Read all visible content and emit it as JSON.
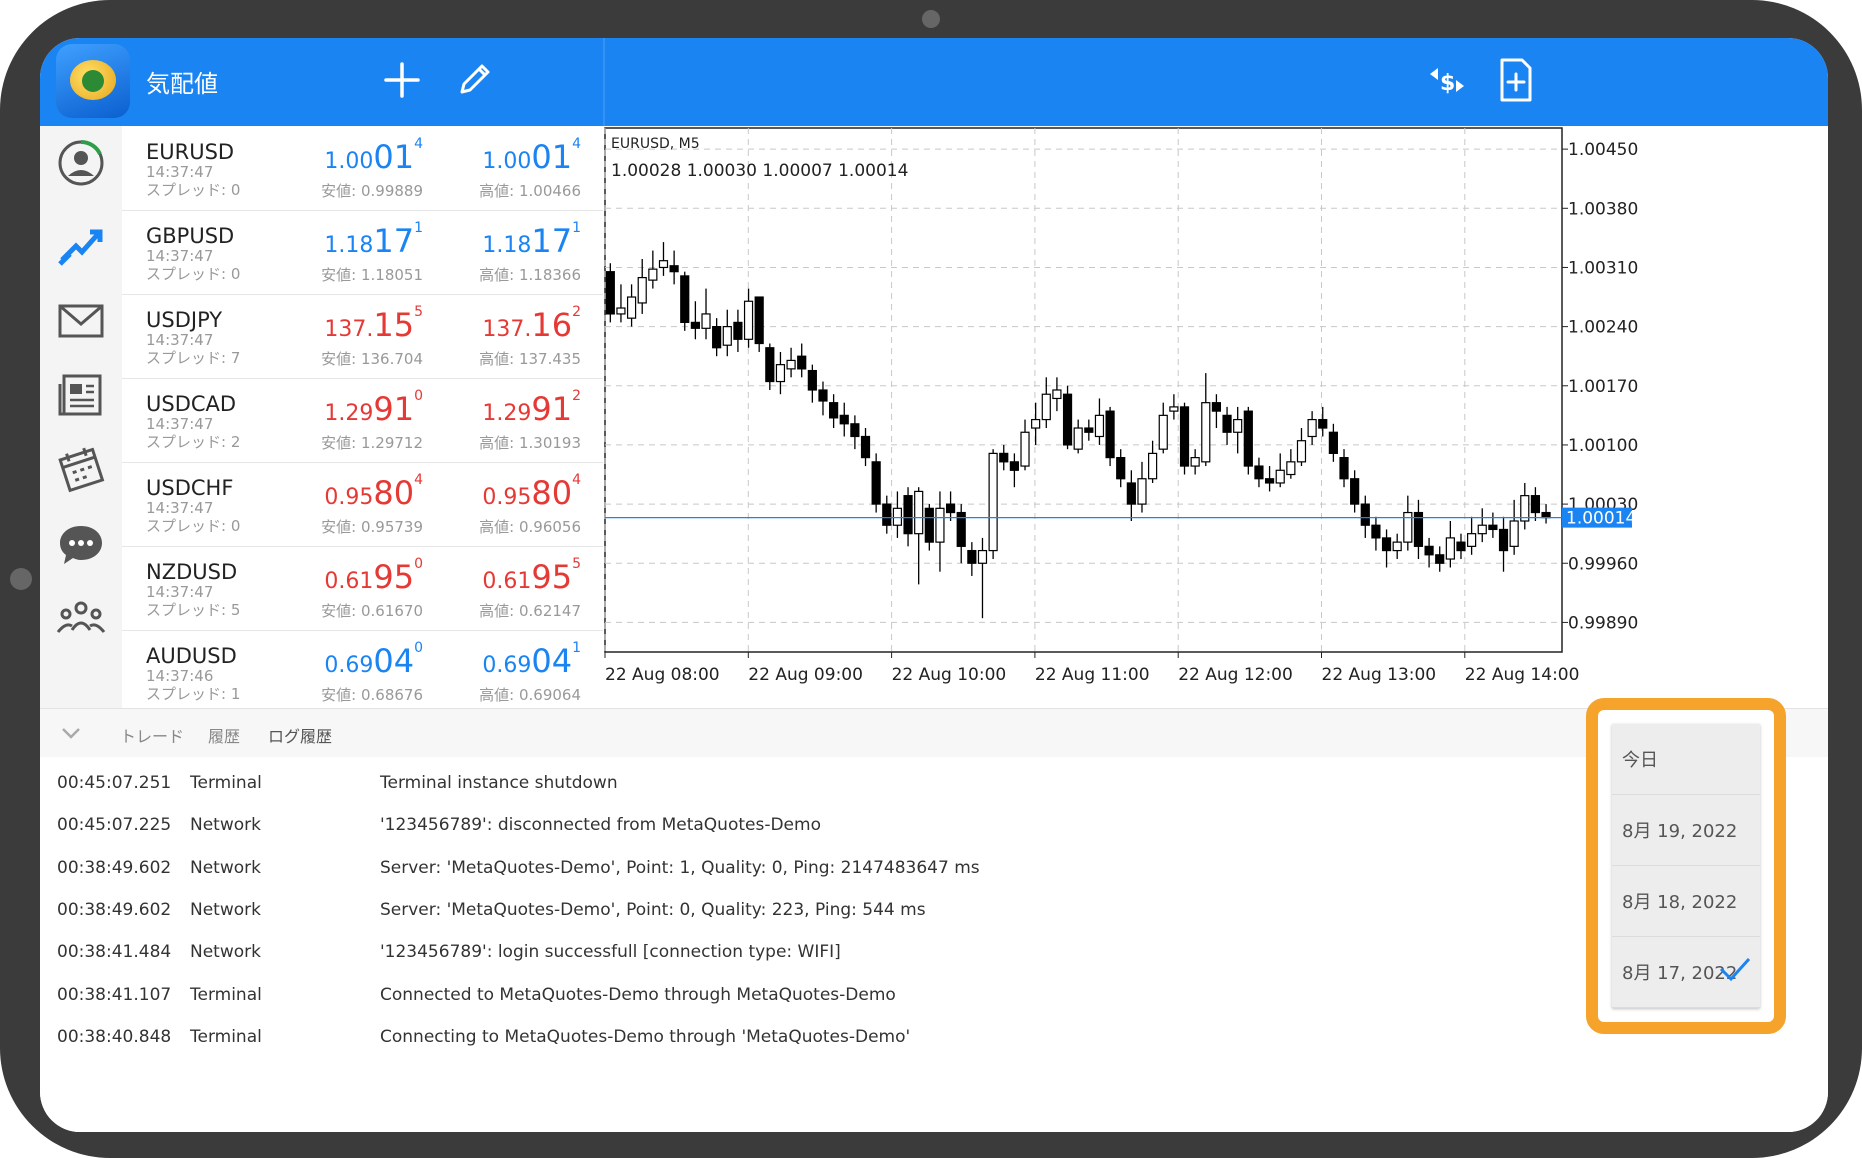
{
  "app": {
    "title": "気配値"
  },
  "quotes": [
    {
      "symbol": "EURUSD",
      "time": "14:37:47",
      "spread": "スプレッド: 0",
      "bid_pre": "1.00",
      "bid_big": "01",
      "bid_sup": "4",
      "ask_pre": "1.00",
      "ask_big": "01",
      "ask_sup": "4",
      "low": "安値: 0.99889",
      "high": "高値: 1.00466",
      "dir": "blue"
    },
    {
      "symbol": "GBPUSD",
      "time": "14:37:47",
      "spread": "スプレッド: 0",
      "bid_pre": "1.18",
      "bid_big": "17",
      "bid_sup": "1",
      "ask_pre": "1.18",
      "ask_big": "17",
      "ask_sup": "1",
      "low": "安値: 1.18051",
      "high": "高値: 1.18366",
      "dir": "blue"
    },
    {
      "symbol": "USDJPY",
      "time": "14:37:47",
      "spread": "スプレッド: 7",
      "bid_pre": "137.",
      "bid_big": "15",
      "bid_sup": "5",
      "ask_pre": "137.",
      "ask_big": "16",
      "ask_sup": "2",
      "low": "安値: 136.704",
      "high": "高値: 137.435",
      "dir": "red"
    },
    {
      "symbol": "USDCAD",
      "time": "14:37:47",
      "spread": "スプレッド: 2",
      "bid_pre": "1.29",
      "bid_big": "91",
      "bid_sup": "0",
      "ask_pre": "1.29",
      "ask_big": "91",
      "ask_sup": "2",
      "low": "安値: 1.29712",
      "high": "高値: 1.30193",
      "dir": "red"
    },
    {
      "symbol": "USDCHF",
      "time": "14:37:47",
      "spread": "スプレッド: 0",
      "bid_pre": "0.95",
      "bid_big": "80",
      "bid_sup": "4",
      "ask_pre": "0.95",
      "ask_big": "80",
      "ask_sup": "4",
      "low": "安値: 0.95739",
      "high": "高値: 0.96056",
      "dir": "red"
    },
    {
      "symbol": "NZDUSD",
      "time": "14:37:47",
      "spread": "スプレッド: 5",
      "bid_pre": "0.61",
      "bid_big": "95",
      "bid_sup": "0",
      "ask_pre": "0.61",
      "ask_big": "95",
      "ask_sup": "5",
      "low": "安値: 0.61670",
      "high": "高値: 0.62147",
      "dir": "red"
    },
    {
      "symbol": "AUDUSD",
      "time": "14:37:46",
      "spread": "スプレッド: 1",
      "bid_pre": "0.69",
      "bid_big": "04",
      "bid_sup": "0",
      "ask_pre": "0.69",
      "ask_big": "04",
      "ask_sup": "1",
      "low": "安値: 0.68676",
      "high": "高値: 0.69064",
      "dir": "blue"
    }
  ],
  "chart": {
    "symbol": "EURUSD, M5",
    "ohlc": "1.00028 1.00030 1.00007 1.00014",
    "current_price": "1.00014",
    "current_value": 1.00014,
    "y_ticks": [
      "1.00450",
      "1.00380",
      "1.00310",
      "1.00240",
      "1.00170",
      "1.00100",
      "1.00030",
      "0.99960",
      "0.99890"
    ],
    "x_ticks": [
      "22 Aug 08:00",
      "22 Aug 09:00",
      "22 Aug 10:00",
      "22 Aug 11:00",
      "22 Aug 12:00",
      "22 Aug 13:00",
      "22 Aug 14:00"
    ]
  },
  "chart_data": {
    "type": "candlestick",
    "title": "EURUSD, M5",
    "ylim": [
      0.99855,
      1.00475
    ],
    "x_range": [
      "22 Aug 08:00",
      "22 Aug 14:00"
    ],
    "grid": true,
    "last": 1.00014,
    "candles": [
      [
        1.00305,
        1.00255,
        1.00315,
        1.00245
      ],
      [
        1.00255,
        1.00262,
        1.0029,
        1.00245
      ],
      [
        1.0025,
        1.00275,
        1.0029,
        1.0024
      ],
      [
        1.00268,
        1.00298,
        1.0032,
        1.00255
      ],
      [
        1.00295,
        1.00308,
        1.0033,
        1.00285
      ],
      [
        1.0031,
        1.00318,
        1.0034,
        1.003
      ],
      [
        1.00312,
        1.00305,
        1.0033,
        1.0029
      ],
      [
        1.003,
        1.00245,
        1.00305,
        1.00235
      ],
      [
        1.00245,
        1.00238,
        1.0027,
        1.00225
      ],
      [
        1.00238,
        1.00255,
        1.00285,
        1.00225
      ],
      [
        1.0024,
        1.00215,
        1.0025,
        1.00205
      ],
      [
        1.00218,
        1.0024,
        1.0026,
        1.00205
      ],
      [
        1.00245,
        1.00225,
        1.0026,
        1.0021
      ],
      [
        1.00225,
        1.0027,
        1.00285,
        1.00215
      ],
      [
        1.00275,
        1.0022,
        1.00275,
        1.0021
      ],
      [
        1.00215,
        1.00175,
        1.0022,
        1.00165
      ],
      [
        1.00175,
        1.00195,
        1.0021,
        1.0016
      ],
      [
        1.0019,
        1.002,
        1.00215,
        1.0018
      ],
      [
        1.00205,
        1.0019,
        1.0022,
        1.0018
      ],
      [
        1.00188,
        1.00165,
        1.00195,
        1.0015
      ],
      [
        1.00165,
        1.00152,
        1.00175,
        1.00135
      ],
      [
        1.0015,
        1.00132,
        1.0016,
        1.0012
      ],
      [
        1.00135,
        1.00125,
        1.0015,
        1.0011
      ],
      [
        1.00125,
        1.0011,
        1.00135,
        1.00095
      ],
      [
        1.0011,
        1.00085,
        1.0012,
        1.00075
      ],
      [
        1.0008,
        1.0003,
        1.0009,
        1.0002
      ],
      [
        1.0003,
        1.00005,
        1.0004,
        0.99995
      ],
      [
        1.00005,
        1.00025,
        1.00045,
        0.9999
      ],
      [
        1.0004,
        0.99995,
        1.0005,
        0.9998
      ],
      [
        0.99995,
        1.00045,
        1.0005,
        0.99935
      ],
      [
        1.00025,
        0.99985,
        1.0003,
        0.99975
      ],
      [
        0.99985,
        1.00025,
        1.00045,
        0.9995
      ],
      [
        1.0003,
        1.0002,
        1.00045,
        1.0001
      ],
      [
        1.0002,
        0.9998,
        1.0003,
        0.9996
      ],
      [
        0.99975,
        0.9996,
        0.99985,
        0.99945
      ],
      [
        0.9996,
        0.99975,
        0.9999,
        0.99895
      ],
      [
        0.99975,
        1.0009,
        1.00095,
        0.99965
      ],
      [
        1.0009,
        1.0008,
        1.001,
        1.0007
      ],
      [
        1.0008,
        1.0007,
        1.0009,
        1.0005
      ],
      [
        1.00075,
        1.00115,
        1.0013,
        1.0007
      ],
      [
        1.0012,
        1.0013,
        1.0015,
        1.001
      ],
      [
        1.0013,
        1.0016,
        1.0018,
        1.0012
      ],
      [
        1.00155,
        1.00165,
        1.0018,
        1.0014
      ],
      [
        1.0016,
        1.001,
        1.0017,
        1.00095
      ],
      [
        1.00095,
        1.0012,
        1.0013,
        1.0009
      ],
      [
        1.0012,
        1.00115,
        1.0013,
        1.00105
      ],
      [
        1.0011,
        1.00135,
        1.00155,
        1.001
      ],
      [
        1.0014,
        1.00085,
        1.00145,
        1.00075
      ],
      [
        1.00085,
        1.0006,
        1.00095,
        1.0005
      ],
      [
        1.00055,
        1.0003,
        1.0007,
        1.0001
      ],
      [
        1.0003,
        1.0006,
        1.0008,
        1.0002
      ],
      [
        1.0006,
        1.0009,
        1.00105,
        1.00055
      ],
      [
        1.00095,
        1.00135,
        1.0015,
        1.0009
      ],
      [
        1.0014,
        1.00145,
        1.0016,
        1.0013
      ],
      [
        1.00145,
        1.00075,
        1.0015,
        1.00065
      ],
      [
        1.00075,
        1.00085,
        1.00095,
        1.00065
      ],
      [
        1.0008,
        1.0015,
        1.00185,
        1.00075
      ],
      [
        1.0015,
        1.0014,
        1.0016,
        1.0012
      ],
      [
        1.00135,
        1.00115,
        1.00145,
        1.001
      ],
      [
        1.00115,
        1.0013,
        1.00145,
        1.0009
      ],
      [
        1.0014,
        1.00075,
        1.00145,
        1.00065
      ],
      [
        1.00075,
        1.0006,
        1.00085,
        1.0005
      ],
      [
        1.0006,
        1.00055,
        1.00075,
        1.00045
      ],
      [
        1.00055,
        1.0007,
        1.0009,
        1.0005
      ],
      [
        1.00065,
        1.0008,
        1.00095,
        1.0006
      ],
      [
        1.0008,
        1.00105,
        1.0012,
        1.00075
      ],
      [
        1.0011,
        1.0013,
        1.0014,
        1.001
      ],
      [
        1.0013,
        1.0012,
        1.00145,
        1.0011
      ],
      [
        1.00115,
        1.0009,
        1.00125,
        1.0008
      ],
      [
        1.00085,
        1.0006,
        1.00095,
        1.0005
      ],
      [
        1.0006,
        1.0003,
        1.0007,
        1.0002
      ],
      [
        1.0003,
        1.00005,
        1.0004,
        0.9999
      ],
      [
        1.00005,
        0.9999,
        1.00015,
        0.99975
      ],
      [
        0.9999,
        0.99975,
        1.0,
        0.99955
      ],
      [
        0.99975,
        0.99985,
        0.99995,
        0.99965
      ],
      [
        0.99985,
        1.0002,
        1.0004,
        0.99975
      ],
      [
        1.0002,
        0.9998,
        1.00035,
        0.99965
      ],
      [
        0.9998,
        0.9997,
        0.9999,
        0.99955
      ],
      [
        0.9997,
        0.9996,
        0.9998,
        0.9995
      ],
      [
        0.99965,
        0.9999,
        1.0001,
        0.99955
      ],
      [
        0.99985,
        0.99975,
        0.99995,
        0.99965
      ],
      [
        0.9998,
        0.99995,
        1.00015,
        0.9997
      ],
      [
        0.99995,
        1.00005,
        1.00025,
        0.99985
      ],
      [
        1.00005,
        1.0,
        1.0002,
        0.9999
      ],
      [
        1.0,
        0.99975,
        1.00015,
        0.9995
      ],
      [
        0.9998,
        1.0001,
        1.00035,
        0.9997
      ],
      [
        1.0001,
        1.0004,
        1.00055,
        1.0
      ],
      [
        1.0004,
        1.0002,
        1.0005,
        1.0001
      ],
      [
        1.0002,
        1.00014,
        1.0003,
        1.00007
      ]
    ]
  },
  "tabs": [
    "トレード",
    "履歴",
    "ログ履歴"
  ],
  "log": [
    {
      "time": "00:45:07.251",
      "source": "Terminal",
      "message": "Terminal instance shutdown"
    },
    {
      "time": "00:45:07.225",
      "source": "Network",
      "message": "'123456789': disconnected from MetaQuotes-Demo"
    },
    {
      "time": "00:38:49.602",
      "source": "Network",
      "message": "Server: 'MetaQuotes-Demo', Point: 1, Quality: 0, Ping: 2147483647 ms"
    },
    {
      "time": "00:38:49.602",
      "source": "Network",
      "message": "Server: 'MetaQuotes-Demo', Point: 0, Quality: 223, Ping: 544 ms"
    },
    {
      "time": "00:38:41.484",
      "source": "Network",
      "message": "'123456789': login successfull [connection type: WIFI]"
    },
    {
      "time": "00:38:41.107",
      "source": "Terminal",
      "message": "Connected to MetaQuotes-Demo through MetaQuotes-Demo"
    },
    {
      "time": "00:38:40.848",
      "source": "Terminal",
      "message": "Connecting to MetaQuotes-Demo through 'MetaQuotes-Demo'"
    }
  ],
  "date_menu": {
    "items": [
      "今日",
      "8月 19, 2022",
      "8月 18, 2022",
      "8月 17, 2022"
    ],
    "selected": "8月 17, 2022"
  },
  "colors": {
    "accent": "#1a84f3",
    "up": "#1a84f3",
    "down": "#e53935",
    "highlight": "#f5a32a"
  }
}
